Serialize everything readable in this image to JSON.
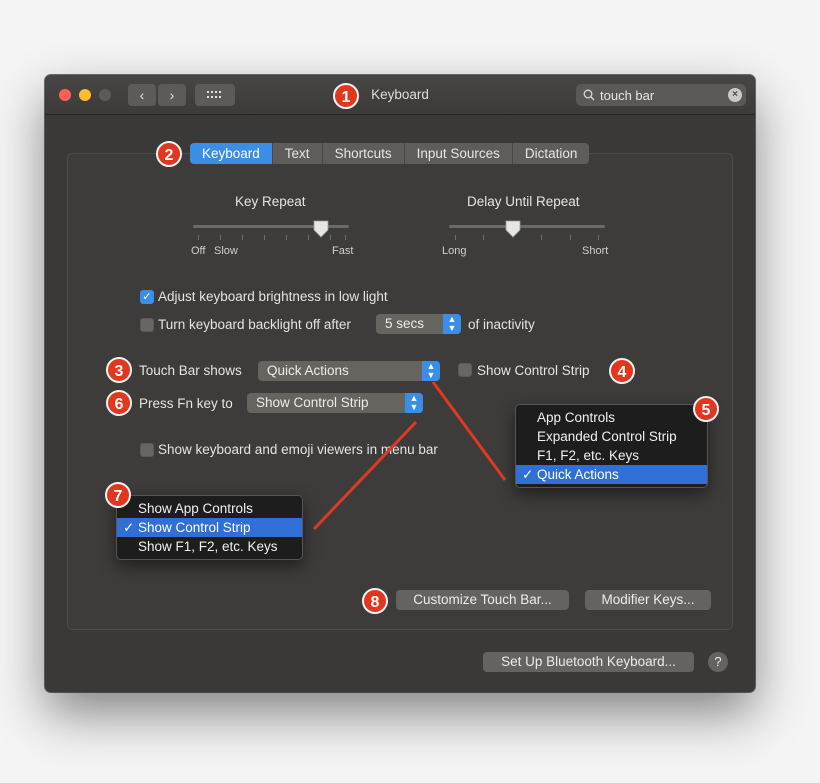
{
  "window": {
    "title": "Keyboard"
  },
  "search": {
    "value": "touch bar"
  },
  "tabs": [
    {
      "label": "Keyboard",
      "active": true
    },
    {
      "label": "Text",
      "active": false
    },
    {
      "label": "Shortcuts",
      "active": false
    },
    {
      "label": "Input Sources",
      "active": false
    },
    {
      "label": "Dictation",
      "active": false
    }
  ],
  "key_repeat": {
    "title": "Key Repeat",
    "off_label": "Off",
    "slow_label": "Slow",
    "fast_label": "Fast"
  },
  "delay_until_repeat": {
    "title": "Delay Until Repeat",
    "long_label": "Long",
    "short_label": "Short"
  },
  "options": {
    "adjust_brightness": {
      "label": "Adjust keyboard brightness in low light",
      "checked": true
    },
    "backlight_off": {
      "label": "Turn keyboard backlight off after",
      "checked": false,
      "select_value": "5 secs",
      "suffix": "of inactivity"
    },
    "touch_bar_shows": {
      "label": "Touch Bar shows",
      "value": "Quick Actions"
    },
    "show_control_strip": {
      "label": "Show Control Strip",
      "checked": false
    },
    "press_fn": {
      "label": "Press Fn key to",
      "value": "Show Control Strip"
    },
    "emoji_viewers": {
      "label": "Show keyboard and emoji viewers in menu bar",
      "checked": false
    }
  },
  "touchbar_menu": {
    "items": [
      "App Controls",
      "Expanded Control Strip",
      "F1, F2, etc. Keys",
      "Quick Actions"
    ],
    "selected": "Quick Actions"
  },
  "fn_menu": {
    "items": [
      "Show App Controls",
      "Show Control Strip",
      "Show F1, F2, etc. Keys"
    ],
    "selected": "Show Control Strip"
  },
  "buttons": {
    "customize_touch_bar": "Customize Touch Bar...",
    "modifier_keys": "Modifier Keys...",
    "bluetooth": "Set Up Bluetooth Keyboard...",
    "help": "?"
  },
  "callouts": [
    "1",
    "2",
    "3",
    "4",
    "5",
    "6",
    "7",
    "8"
  ],
  "colors": {
    "accent": "#3a8ee6",
    "callout": "#e3361e",
    "window_bg": "#3a3937"
  }
}
